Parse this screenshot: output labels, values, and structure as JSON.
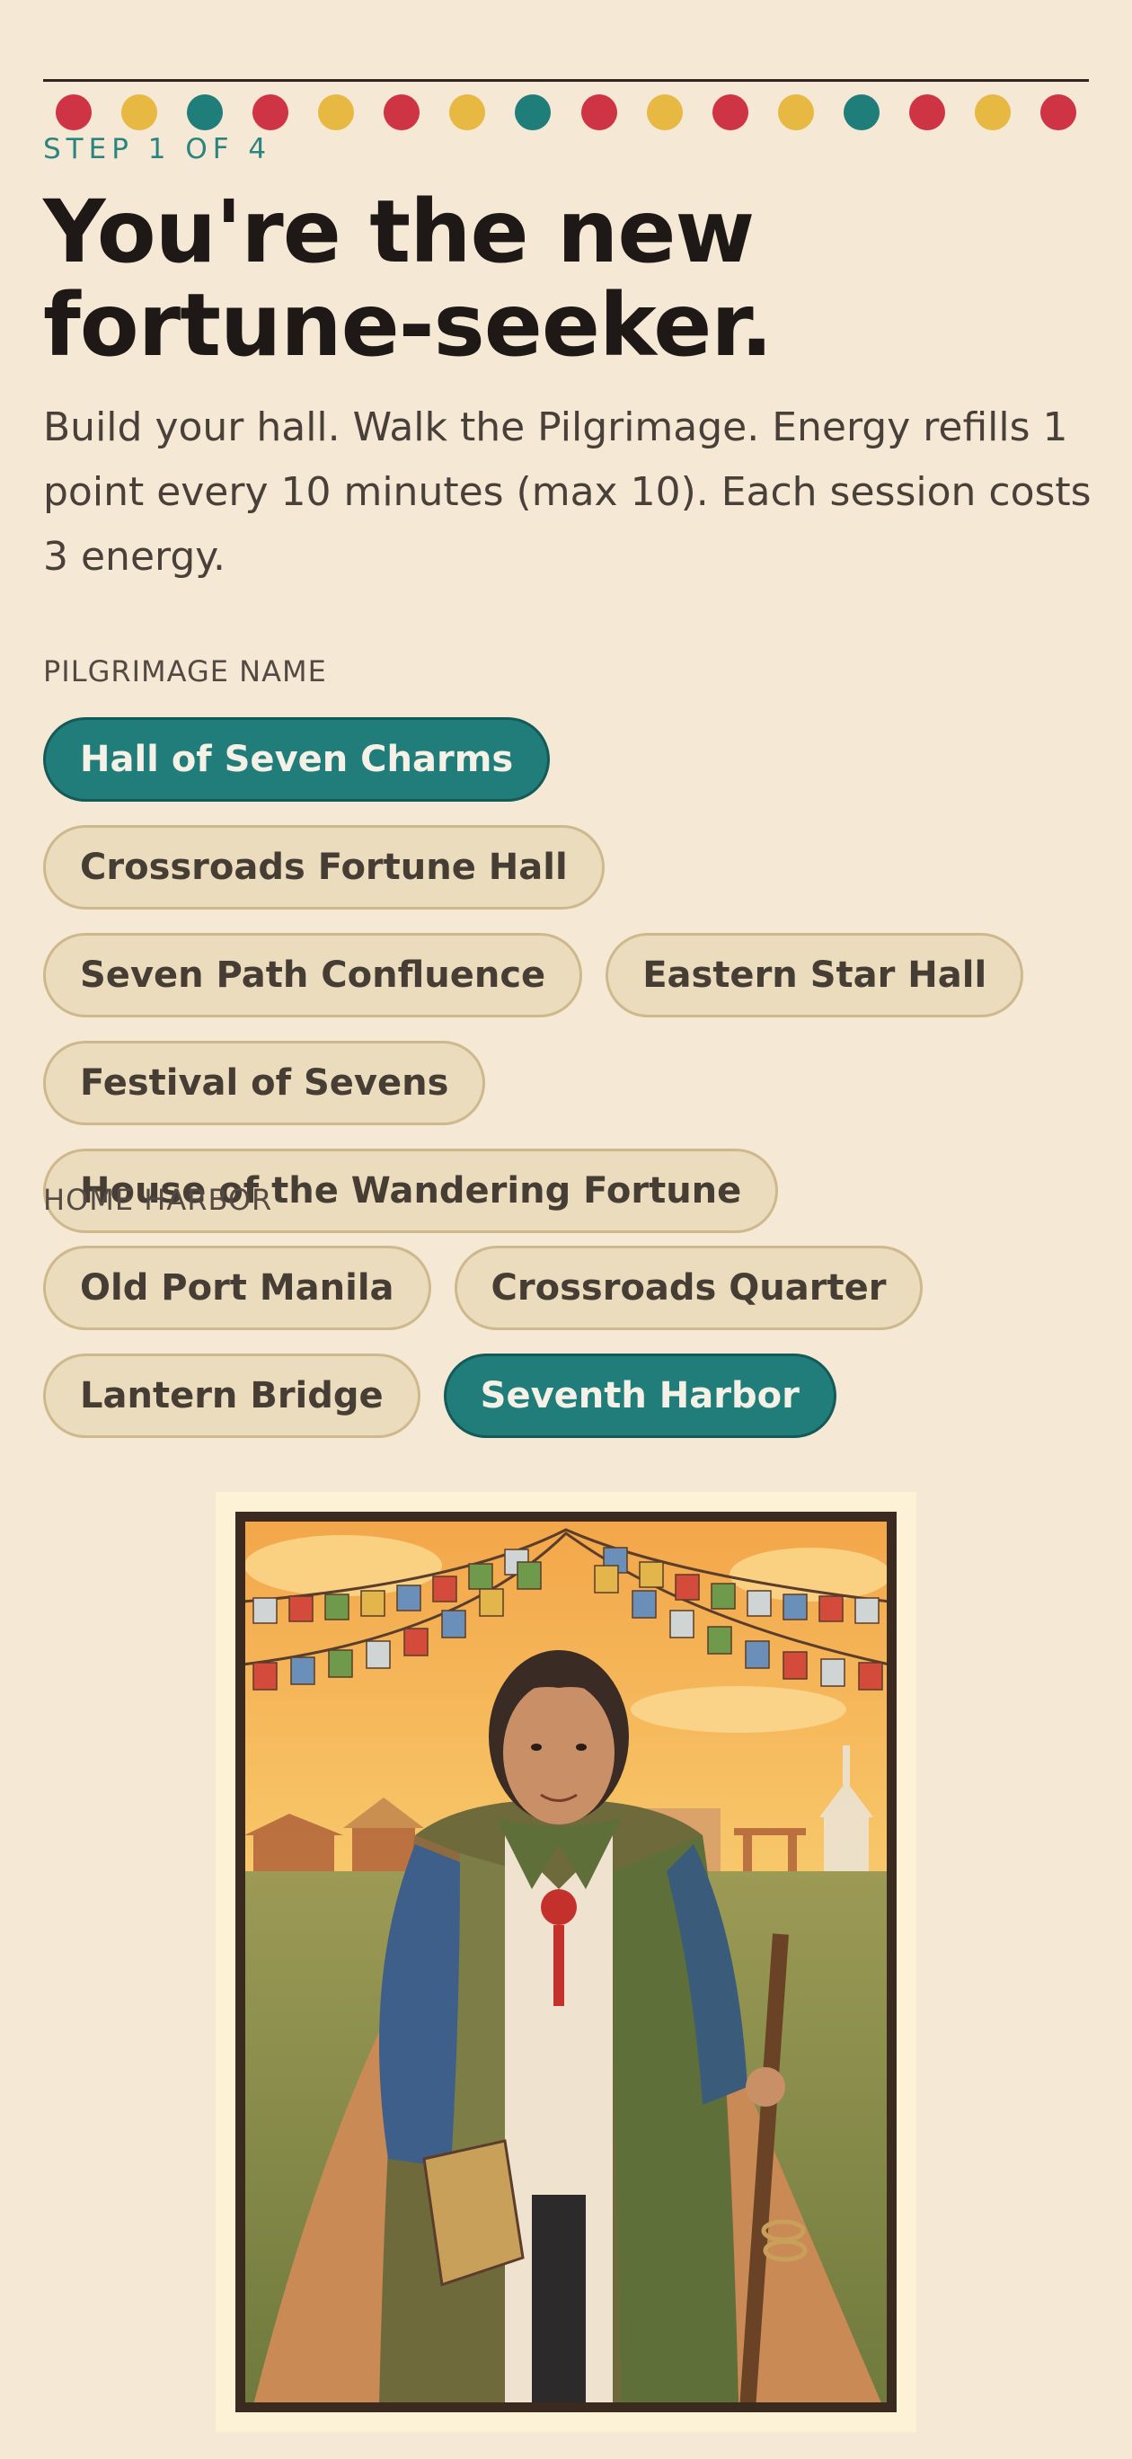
{
  "progress": {
    "dots": [
      "#cf3444",
      "#e7b842",
      "#1f7e7a",
      "#cf3444",
      "#e7b842",
      "#cf3444",
      "#e7b842",
      "#1f7e7a",
      "#cf3444",
      "#e7b842",
      "#cf3444",
      "#e7b842",
      "#1f7e7a",
      "#cf3444",
      "#e7b842",
      "#cf3444"
    ],
    "step_label": "STEP 1 OF 4"
  },
  "heading": "You're the new fortune-seeker.",
  "intro": "Build your hall. Walk the Pilgrimage. Energy refills 1 point every 10 minutes (max 10). Each session costs 3 energy.",
  "pilgrimage_name": {
    "label": "PILGRIMAGE NAME",
    "options": [
      {
        "label": "Hall of Seven Charms",
        "selected": true
      },
      {
        "label": "Crossroads Fortune Hall",
        "selected": false
      },
      {
        "label": "Seven Path Confluence",
        "selected": false
      },
      {
        "label": "Eastern Star Hall",
        "selected": false
      },
      {
        "label": "Festival of Sevens",
        "selected": false
      },
      {
        "label": "House of the Wandering Fortune",
        "selected": false
      }
    ]
  },
  "home_harbor": {
    "label": "HOME HARBOR",
    "options": [
      {
        "label": "Old Port Manila",
        "selected": false
      },
      {
        "label": "Crossroads Quarter",
        "selected": false
      },
      {
        "label": "Lantern Bridge",
        "selected": false
      },
      {
        "label": "Seventh Harbor",
        "selected": true
      }
    ]
  },
  "colors": {
    "accent": "#207d7a",
    "background": "#f5e8d4",
    "chip": "#ebdcbd"
  },
  "illustration": {
    "subject": "pilgrim-portrait"
  }
}
